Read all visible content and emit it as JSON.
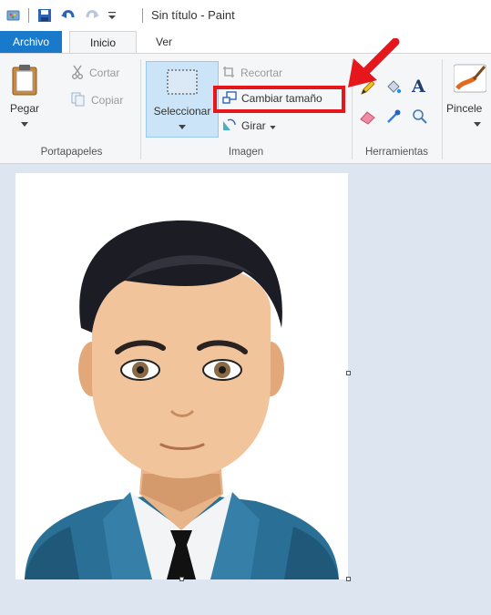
{
  "window": {
    "title": "Sin título - Paint"
  },
  "quick_access": {
    "app_icon": "paint-app-icon",
    "save_icon": "save-icon",
    "undo_icon": "undo-icon",
    "redo_icon": "redo-icon",
    "customize_icon": "customize-dropdown-icon"
  },
  "tabs": [
    {
      "label": "Archivo"
    },
    {
      "label": "Inicio"
    },
    {
      "label": "Ver"
    }
  ],
  "ribbon": {
    "clipboard": {
      "paste_label": "Pegar",
      "cut_label": "Cortar",
      "copy_label": "Copiar",
      "group_label": "Portapapeles"
    },
    "image": {
      "select_label": "Seleccionar",
      "crop_label": "Recortar",
      "resize_label": "Cambiar tamaño",
      "rotate_label": "Girar",
      "group_label": "Imagen"
    },
    "tools": {
      "group_label": "Herramientas",
      "text_tool_glyph": "A"
    },
    "brushes": {
      "label": "Pincele"
    }
  },
  "colors": {
    "accent": "#1979ca",
    "annotation_red": "#e5171d",
    "workspace": "#dde5f0"
  }
}
